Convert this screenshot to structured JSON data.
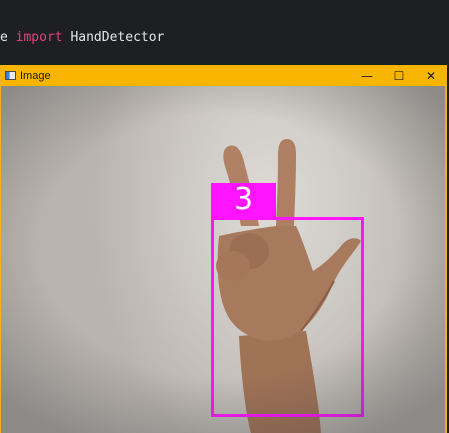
{
  "editor": {
    "code_prefix": "e ",
    "code_keyword": "import",
    "code_suffix": " HandDetector"
  },
  "window": {
    "title": "Image",
    "minimize_glyph": "—",
    "maximize_glyph": "☐",
    "close_glyph": "✕",
    "icon": "app-window-icon"
  },
  "detection": {
    "finger_count": "3",
    "box_color": "#ff14ff",
    "label_color": "#ff14ff"
  },
  "colors": {
    "titlebar": "#f7b500",
    "keyword": "#e0437c",
    "editor_bg": "#1e1f22"
  }
}
